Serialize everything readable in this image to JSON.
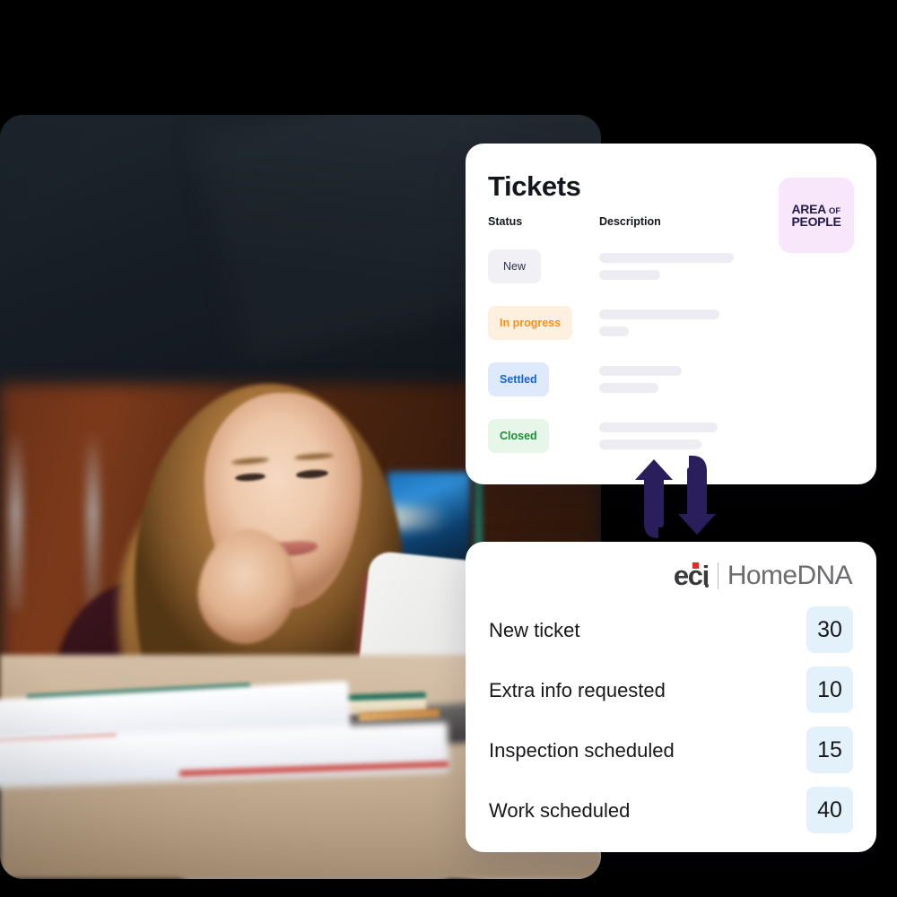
{
  "photo": {
    "alt": "Smiling woman working at a laptop at a desk with books and papers"
  },
  "tickets_card": {
    "title": "Tickets",
    "logo": {
      "line1_main": "AREA",
      "line1_small": "OF",
      "line2": "PEOPLE",
      "background": "#f8e6fb",
      "text_color": "#221b4a"
    },
    "columns": {
      "status": "Status",
      "description": "Description"
    },
    "rows": [
      {
        "status": "New",
        "bg": "#f1f0f5",
        "fg": "#2e3045",
        "line1_width": 150,
        "line2_width": 68
      },
      {
        "status": "In progress",
        "bg": "#fdf0de",
        "fg": "#f5901f",
        "line1_width": 134,
        "line2_width": 33
      },
      {
        "status": "Settled",
        "bg": "#deeafb",
        "fg": "#1565d8",
        "line1_width": 92,
        "line2_width": 66
      },
      {
        "status": "Closed",
        "bg": "#e6f6e9",
        "fg": "#1e8c3a",
        "line1_width": 132,
        "line2_width": 114
      }
    ]
  },
  "sync_icon": {
    "name": "sync-arrows-icon",
    "color": "#2a1f5c"
  },
  "summary_card": {
    "logo": {
      "mark": "eci",
      "word": "HomeDNA",
      "dot_color": "#e8262d",
      "mark_color": "#3a3a3c",
      "word_color": "#6c6c70"
    },
    "badge_background": "#e2f1fa",
    "rows": [
      {
        "label": "New ticket",
        "count": "30"
      },
      {
        "label": "Extra info requested",
        "count": "10"
      },
      {
        "label": "Inspection scheduled",
        "count": "15"
      },
      {
        "label": "Work scheduled",
        "count": "40"
      }
    ]
  }
}
